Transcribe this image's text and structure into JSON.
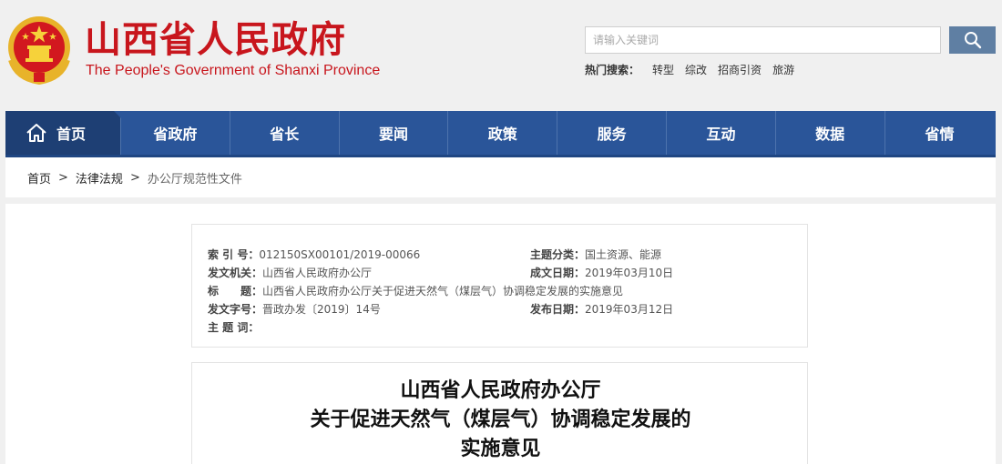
{
  "header": {
    "title": "山西省人民政府",
    "subtitle": "The People's Government of Shanxi Province",
    "emblem_icon": "national-emblem-icon"
  },
  "search": {
    "placeholder": "请输入关键词",
    "button_icon": "search-icon",
    "hot_label": "热门搜索：",
    "hot_terms": [
      "转型",
      "综改",
      "招商引资",
      "旅游"
    ]
  },
  "nav": {
    "home_icon": "home-icon",
    "items": [
      "首页",
      "省政府",
      "省长",
      "要闻",
      "政策",
      "服务",
      "互动",
      "数据",
      "省情"
    ]
  },
  "breadcrumb": {
    "items": [
      "首页",
      "法律法规",
      "办公厅规范性文件"
    ],
    "separator": ">"
  },
  "meta": {
    "index_label": "索 引 号：",
    "index_value": "012150SX00101/2019-00066",
    "topic_label": "主题分类：",
    "topic_value": "国土资源、能源",
    "issuer_label": "发文机关：",
    "issuer_value": "山西省人民政府办公厅",
    "date_written_label": "成文日期：",
    "date_written_value": "2019年03月10日",
    "title_label": "标　　题：",
    "title_value": "山西省人民政府办公厅关于促进天然气（煤层气）协调稳定发展的实施意见",
    "doc_no_label": "发文字号：",
    "doc_no_value": "晋政办发〔2019〕14号",
    "publish_label": "发布日期：",
    "publish_value": "2019年03月12日",
    "keywords_label": "主 题 词：",
    "keywords_value": ""
  },
  "document": {
    "title_lines": [
      "山西省人民政府办公厅",
      "关于促进天然气（煤层气）协调稳定发展的",
      "实施意见"
    ]
  },
  "colors": {
    "brand_red": "#c8161d",
    "nav_blue": "#2a5599",
    "nav_home_blue": "#1e3f74",
    "search_button": "#5f7fa3"
  }
}
